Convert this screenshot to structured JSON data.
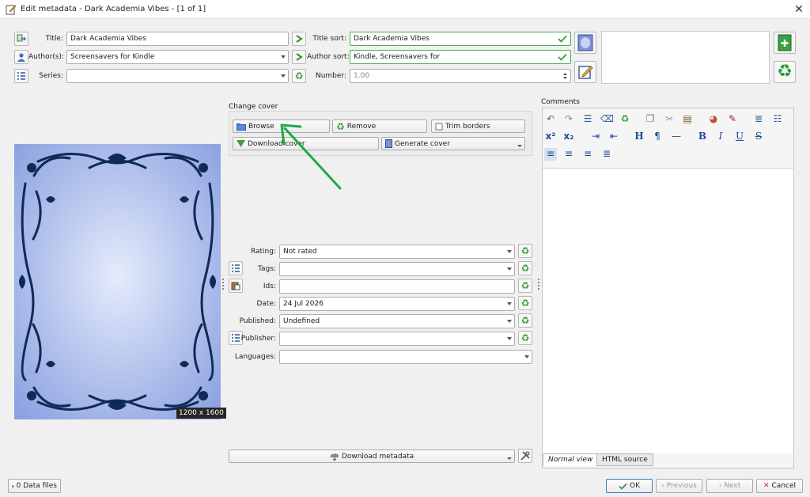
{
  "window": {
    "title": "Edit metadata - Dark Academia Vibes - [1 of 1]",
    "close_glyph": "✕"
  },
  "fields": {
    "title": {
      "label": "Title:",
      "value": "Dark Academia Vibes"
    },
    "title_sort": {
      "label": "Title sort:",
      "value": "Dark Academia Vibes"
    },
    "authors": {
      "label": "Author(s):",
      "value": "Screensavers for Kindle"
    },
    "author_sort": {
      "label": "Author sort:",
      "value": "Kindle, Screensavers for"
    },
    "series": {
      "label": "Series:",
      "value": ""
    },
    "number": {
      "label": "Number:",
      "value": "1.00"
    },
    "rating": {
      "label": "Rating:",
      "value": "Not rated"
    },
    "tags": {
      "label": "Tags:",
      "value": ""
    },
    "ids": {
      "label": "Ids:",
      "value": ""
    },
    "date": {
      "label": "Date:",
      "value": "24 Jul 2026"
    },
    "published": {
      "label": "Published:",
      "value": "Undefined"
    },
    "publisher": {
      "label": "Publisher:",
      "value": ""
    },
    "languages": {
      "label": "Languages:",
      "value": ""
    }
  },
  "cover": {
    "resolution": "1200 x 1600",
    "section_label": "Change cover",
    "browse": "Browse",
    "remove": "Remove",
    "trim": "Trim borders",
    "download": "Download cover",
    "generate": "Generate cover"
  },
  "download_metadata": "Download metadata",
  "comments": {
    "label": "Comments",
    "tabs": [
      "Normal view",
      "HTML source"
    ]
  },
  "footer": {
    "data_files": "0 Data files",
    "ok": "OK",
    "previous": "Previous",
    "next": "Next",
    "cancel": "Cancel"
  },
  "colors": {
    "accent_green": "#4caf50",
    "cover_bg": "#a8b9ea",
    "arrow_green": "#1fa84a"
  }
}
